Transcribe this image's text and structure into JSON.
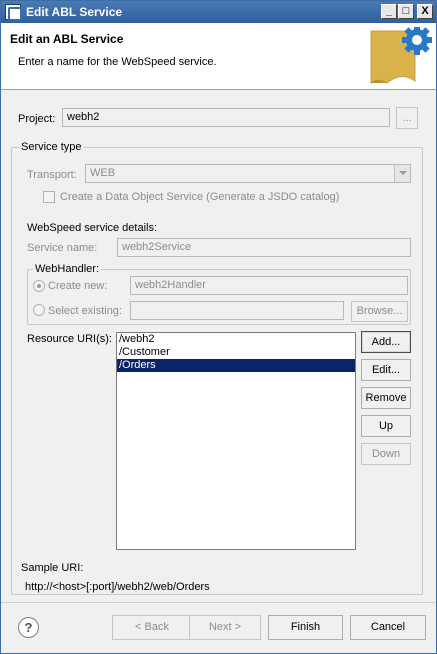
{
  "window": {
    "title": "Edit ABL Service",
    "controls": {
      "minimize": "_",
      "maximize": "□",
      "close": "X"
    }
  },
  "banner": {
    "heading": "Edit an ABL Service",
    "description": "Enter a name for the WebSpeed service."
  },
  "project": {
    "label": "Project:",
    "value": "webh2",
    "browse_label": "..."
  },
  "service_type": {
    "group_title": "Service type",
    "transport_label": "Transport:",
    "transport_value": "WEB",
    "data_object_checkbox_label": "Create a Data Object Service (Generate a JSDO catalog)",
    "data_object_checked": false
  },
  "webspeed": {
    "section_label": "WebSpeed service details:",
    "service_name_label": "Service name:",
    "service_name_value": "webh2Service",
    "webhandler": {
      "group_title": "WebHandler:",
      "create_new_label": "Create new:",
      "create_new_value": "webh2Handler",
      "create_new_selected": true,
      "select_existing_label": "Select existing:",
      "select_existing_value": "",
      "browse_label": "Browse..."
    }
  },
  "resources": {
    "label": "Resource URI(s):",
    "items": [
      "/webh2",
      "/Customer",
      "/Orders"
    ],
    "selected_index": 2,
    "buttons": {
      "add": "Add...",
      "edit": "Edit...",
      "remove": "Remove",
      "up": "Up",
      "down": "Down"
    }
  },
  "sample_uri": {
    "label": "Sample URI:",
    "value": "http://<host>[:port]/webh2/web/Orders"
  },
  "footer": {
    "help_icon": "?",
    "back_label": "< Back",
    "next_label": "Next >",
    "finish_label": "Finish",
    "cancel_label": "Cancel"
  },
  "colors": {
    "titlebar": "#2f5f9e",
    "selection": "#0a246a",
    "banner_graphic": "#d9b24a",
    "gear": "#2b78c8"
  },
  "icons": {
    "app": "abl-service-icon",
    "banner": "wizard-banner-icon"
  }
}
